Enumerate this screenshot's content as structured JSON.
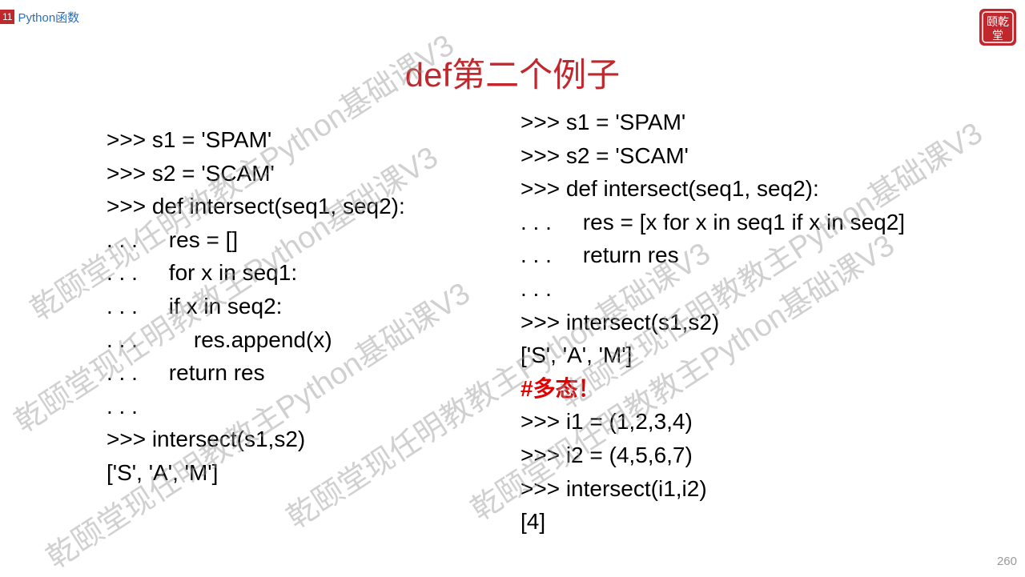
{
  "header": {
    "chapter_number": "11",
    "chapter_title": "Python函数"
  },
  "logo": {
    "icon": "seal-logo-icon",
    "lettering": "颐乾堂",
    "color": "#c0282d"
  },
  "title": "def第二个例子",
  "left_code": [
    ">>> s1 = 'SPAM'",
    ">>> s2 = 'SCAM'",
    ">>> def intersect(seq1, seq2):",
    ". . .     res = []",
    ". . .     for x in seq1:",
    ". . .     if x in seq2:",
    ". . .         res.append(x)",
    ". . .     return res",
    ". . .",
    ">>> intersect(s1,s2)",
    "['S', 'A', 'M']"
  ],
  "right_code": [
    ">>> s1 = 'SPAM'",
    ">>> s2 = 'SCAM'",
    ">>> def intersect(seq1, seq2):",
    ". . .     res = [x for x in seq1 if x in seq2]",
    ". . .     return res",
    ". . .",
    ">>> intersect(s1,s2)",
    "['S', 'A', 'M']",
    "#多态！",
    ">>> i1 = (1,2,3,4)",
    ">>> i2 = (4,5,6,7)",
    ">>> intersect(i1,i2)",
    "[4]"
  ],
  "watermark_texts": [
    "乾颐堂现任明教教主Python基础课V3",
    "乾颐堂现任明教教主Python基础课V3",
    "乾颐堂现任明教教主Python基础课V3",
    "乾颐堂现任明教教主Python基础课V3",
    "乾颐堂现任明教教主Python基础课V3",
    "乾颐堂现任明教教主Python基础课V3"
  ],
  "page_number": "260",
  "colors": {
    "title": "#c0282d",
    "chapter_badge": "#c0282d",
    "chapter_text": "#2e6fb3",
    "comment": "#e00000"
  }
}
